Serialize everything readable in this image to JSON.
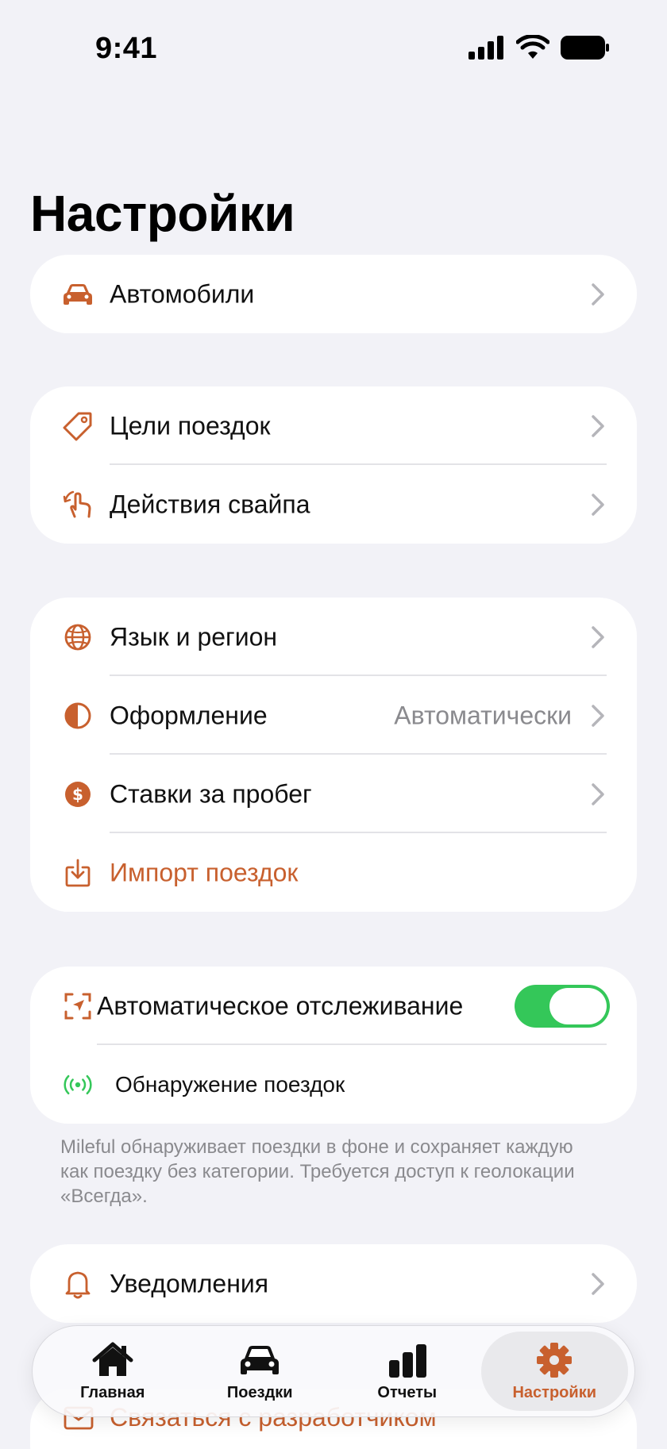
{
  "status_bar": {
    "time": "9:41",
    "icons": [
      "signal-icon",
      "wifi-icon",
      "battery-icon"
    ]
  },
  "page": {
    "title": "Настройки"
  },
  "colors": {
    "accent": "#C8602E",
    "toggle_on": "#34C759",
    "secondary_text": "#8A8A8E"
  },
  "groups": {
    "vehicles": {
      "items": [
        {
          "icon": "car-icon",
          "label": "Автомобили"
        }
      ]
    },
    "trips": {
      "items": [
        {
          "icon": "tag-icon",
          "label": "Цели поездок"
        },
        {
          "icon": "swipe-hand-icon",
          "label": "Действия свайпа"
        }
      ]
    },
    "general": {
      "items": [
        {
          "icon": "globe-icon",
          "label": "Язык и регион"
        },
        {
          "icon": "appearance-icon",
          "label": "Оформление",
          "value": "Автоматически"
        },
        {
          "icon": "dollar-icon",
          "label": "Ставки за пробег"
        },
        {
          "icon": "import-icon",
          "label": "Импорт поездок"
        }
      ]
    },
    "tracking": {
      "items": [
        {
          "icon": "tracking-icon",
          "label": "Автоматическое отслеживание",
          "toggle": true
        },
        {
          "icon": "broadcast-icon",
          "label": "Обнаружение поездок"
        }
      ],
      "footnote": "Mileful обнаруживает поездки в фоне и сохраняет каждую как поездку без категории. Требуется доступ к геолокации «Всегда»."
    },
    "notifications": {
      "items": [
        {
          "icon": "bell-icon",
          "label": "Уведомления"
        },
        {
          "icon": "mail-icon",
          "label": "Связаться с разработчиком"
        }
      ]
    }
  },
  "tab_bar": {
    "tabs": [
      {
        "icon": "home-icon",
        "label": "Главная"
      },
      {
        "icon": "car-icon",
        "label": "Поездки"
      },
      {
        "icon": "chart-icon",
        "label": "Отчеты"
      },
      {
        "icon": "gear-icon",
        "label": "Настройки",
        "active": true
      }
    ]
  }
}
